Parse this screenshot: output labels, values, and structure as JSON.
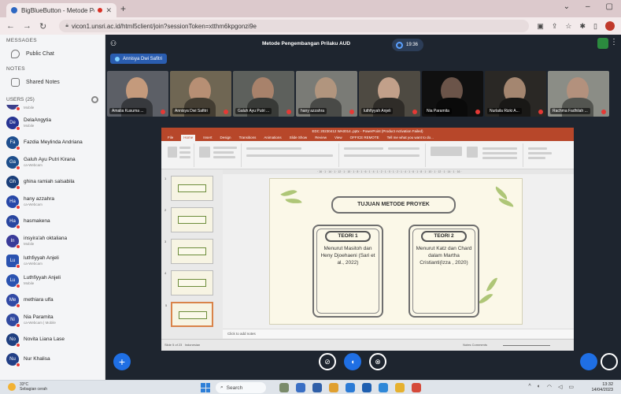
{
  "browser": {
    "tab_title": "BigBlueButton - Metode Pen",
    "url": "vicon1.unsri.ac.id/html5client/join?sessionToken=xtthm6kpgonzi9e"
  },
  "sidebar": {
    "messages_header": "MESSAGES",
    "public_chat": "Public Chat",
    "notes_header": "NOTES",
    "shared_notes": "Shared Notes",
    "users_header": "USERS (25)",
    "users": [
      {
        "initials": "",
        "name": "",
        "role": "Mobile",
        "color": "#3b3f8c"
      },
      {
        "initials": "De",
        "name": "DelaAngytia",
        "role": "Mobile",
        "color": "#283593"
      },
      {
        "initials": "Fa",
        "name": "Fazdia Meylinda Andriana",
        "role": "",
        "color": "#1f4f8f"
      },
      {
        "initials": "Ga",
        "name": "Galuh Ayu Putri Kirana",
        "role": "ca-Webcam",
        "color": "#1e4f8c"
      },
      {
        "initials": "Gh",
        "name": "ghina ramiah salsabila",
        "role": "",
        "color": "#1b3f7a"
      },
      {
        "initials": "Ha",
        "name": "hany azzahra",
        "role": "ca-Webcam",
        "color": "#2848a8"
      },
      {
        "initials": "Ha",
        "name": "hasmakena",
        "role": "",
        "color": "#2946a0"
      },
      {
        "initials": "In",
        "name": "insyira'ah oktaliana",
        "role": "Mobile",
        "color": "#3a3b99"
      },
      {
        "initials": "Lu",
        "name": "luthfiyyah Anjeli",
        "role": "ca-Webcam",
        "color": "#2a52b0"
      },
      {
        "initials": "Lu",
        "name": "Luthfiyyah Anjeli",
        "role": "Mobile",
        "color": "#2a52b0"
      },
      {
        "initials": "Me",
        "name": "methiara ulfa",
        "role": "",
        "color": "#3149a5"
      },
      {
        "initials": "Ni",
        "name": "Nia Paramita",
        "role": "ca-Webcam | Mobile",
        "color": "#3049a0"
      },
      {
        "initials": "No",
        "name": "Novita Liana Lase",
        "role": "",
        "color": "#1f3f80"
      },
      {
        "initials": "Nu",
        "name": "Nur Khalisa",
        "role": "",
        "color": "#223f86"
      }
    ]
  },
  "meeting": {
    "title": "Metode Pengembangan Prilaku AUD",
    "timer": "19:36",
    "presenter": "Annisya Dwi Safitri"
  },
  "webcams": [
    {
      "label": "Amalia Kusuma ...",
      "bg": "#5c5f66",
      "skin": "#c49a7c"
    },
    {
      "label": "Annisya Dwi Safitri",
      "bg": "#6f6653",
      "skin": "#b78f74"
    },
    {
      "label": "Galuh Ayu Putri ...",
      "bg": "#5d605c",
      "skin": "#a8826b"
    },
    {
      "label": "hany azzahra",
      "bg": "#7a7b76",
      "skin": "#b1957e"
    },
    {
      "label": "luthfiyyah Anjeli",
      "bg": "#4e4a42",
      "skin": "#c2a08a"
    },
    {
      "label": "Nia Paramita",
      "bg": "#101010",
      "skin": "#6b5449"
    },
    {
      "label": "Nurlaila Rizki A...",
      "bg": "#2a2825",
      "skin": "#a48670"
    },
    {
      "label": "Rachma Fadhilah ...",
      "bg": "#8b8d86",
      "skin": "#b3917d"
    }
  ],
  "powerpoint": {
    "title_bar": "EDC 20230412 WA0014..pptx - PowerPoint (Product Activation Failed)",
    "tabs": [
      "File",
      "Home",
      "Insert",
      "Design",
      "Transitions",
      "Animations",
      "Slide Show",
      "Review",
      "View",
      "OFFICE REMOTE",
      "Tell me what you want to do..."
    ],
    "slide_title": "TUJUAN METODE PROYEK",
    "card1_title": "TEORI 1",
    "card1_body": "Menurut Masitoh dan Heny Djoehaeni (Sari et al., 2022)",
    "card2_title": "TEORI 2",
    "card2_body": "Menurut Katz dan Chard dalam Martha Cristianti(Izza , 2020)",
    "notes_placeholder": "Click to add notes",
    "status_left": "Slide 5 of 23",
    "status_lang": "Indonesian",
    "status_right": "Notes  Comments",
    "thumb_numbers": [
      "1",
      "2",
      "3",
      "4",
      "5"
    ]
  },
  "taskbar": {
    "temp": "33°C",
    "weather": "Sebagian cerah",
    "search": "Search",
    "time": "13:32",
    "date": "14/04/2023"
  }
}
